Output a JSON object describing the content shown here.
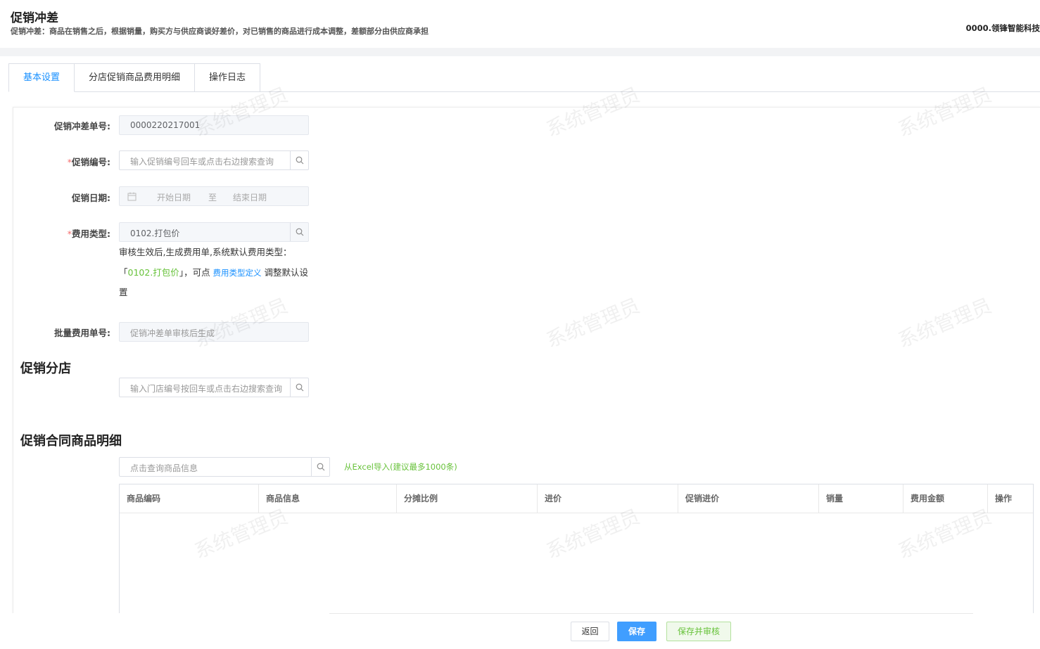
{
  "header": {
    "title": "促销冲差",
    "description": "促销冲差：商品在销售之后，根据销量，购买方与供应商谈好差价，对已销售的商品进行成本调整，差额部分由供应商承担",
    "company": "0000.领锋智能科技"
  },
  "tabs": [
    {
      "label": "基本设置",
      "active": true
    },
    {
      "label": "分店促销商品费用明细",
      "active": false
    },
    {
      "label": "操作日志",
      "active": false
    }
  ],
  "form": {
    "order_no_label": "促销冲差单号:",
    "order_no_value": "0000220217001",
    "promo_no_label": "促销编号:",
    "promo_no_required": "*",
    "promo_no_placeholder": "输入促销编号回车或点击右边搜索查询",
    "promo_date_label": "促销日期:",
    "date_start_placeholder": "开始日期",
    "date_separator": "至",
    "date_end_placeholder": "结束日期",
    "fee_type_label": "费用类型:",
    "fee_type_required": "*",
    "fee_type_value": "0102.打包价",
    "hint_before": "审核生效后,生成费用单,系统默认费用类型：「",
    "hint_highlight": "0102.打包价",
    "hint_middle": "」，可点 ",
    "hint_link": "费用类型定义",
    "hint_after": " 调整默认设置",
    "batch_no_label": "批量费用单号:",
    "batch_no_placeholder": "促销冲差单审核后生成"
  },
  "store_section": {
    "title": "促销分店",
    "search_placeholder": "输入门店编号按回车或点击右边搜索查询"
  },
  "goods_section": {
    "title": "促销合同商品明细",
    "search_placeholder": "点击查询商品信息",
    "import_link": "从Excel导入(建议最多1000条)",
    "columns": [
      "商品编码",
      "商品信息",
      "分摊比例",
      "进价",
      "促销进价",
      "销量",
      "费用金额",
      "操作"
    ]
  },
  "footer": {
    "back_label": "返回",
    "save_label": "保存",
    "save_audit_label": "保存并审核"
  },
  "watermark": "系统管理员",
  "colors": {
    "primary": "#409eff",
    "success": "#67c23a",
    "required": "#f56c6c"
  }
}
